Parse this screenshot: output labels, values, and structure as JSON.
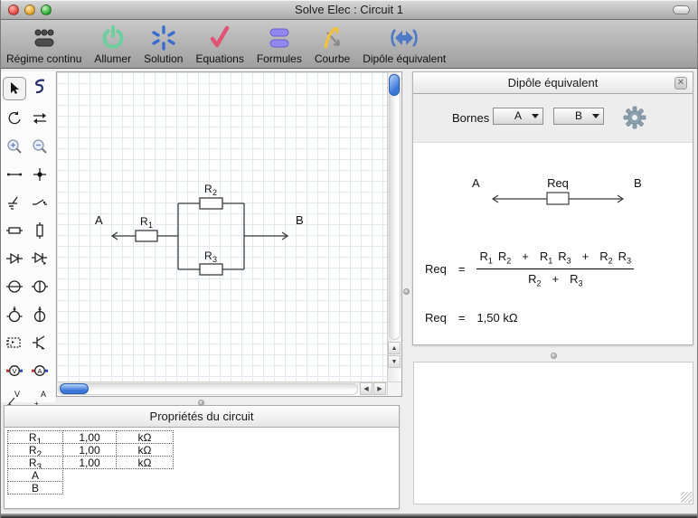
{
  "window": {
    "title": "Solve Elec : Circuit 1"
  },
  "titlebar": {
    "buttons": [
      "close",
      "minimize",
      "zoom"
    ],
    "toolbar_toggle": "pill"
  },
  "toolbar": {
    "items": [
      {
        "id": "regime-continu",
        "label": "Régime continu",
        "icon": "dc-supply-icon"
      },
      {
        "id": "allumer",
        "label": "Allumer",
        "icon": "power-icon"
      },
      {
        "id": "solution",
        "label": "Solution",
        "icon": "spark-icon"
      },
      {
        "id": "equations",
        "label": "Equations",
        "icon": "checkmark-icon"
      },
      {
        "id": "formules",
        "label": "Formules",
        "icon": "bars-icon"
      },
      {
        "id": "courbe",
        "label": "Courbe",
        "icon": "curve-icon"
      },
      {
        "id": "dipole-equivalent",
        "label": "Dipôle équivalent",
        "icon": "dipole-icon"
      }
    ]
  },
  "palette": {
    "tools": [
      {
        "id": "select-tool",
        "icon": "cursor",
        "selected": true
      },
      {
        "id": "freehand-wire-tool",
        "icon": "freehand",
        "selected": false
      },
      {
        "id": "rotate-tool",
        "icon": "rotate",
        "selected": false
      },
      {
        "id": "flip-tool",
        "icon": "swap",
        "selected": false
      },
      {
        "id": "zoom-in-tool",
        "icon": "zoomin",
        "selected": false
      },
      {
        "id": "zoom-out-tool",
        "icon": "zoomout",
        "selected": false
      },
      {
        "id": "wire-tool",
        "icon": "wire",
        "selected": false
      },
      {
        "id": "node-tool",
        "icon": "node",
        "selected": false
      },
      {
        "id": "ground-tool",
        "icon": "ground",
        "selected": false
      },
      {
        "id": "switch-tool",
        "icon": "switch",
        "selected": false
      },
      {
        "id": "resistor-h-tool",
        "icon": "resh",
        "selected": false
      },
      {
        "id": "resistor-v-tool",
        "icon": "resv",
        "selected": false
      },
      {
        "id": "diode-tool",
        "icon": "diode",
        "selected": false
      },
      {
        "id": "photodiode-tool",
        "icon": "photodiode",
        "selected": false
      },
      {
        "id": "voltage-source-tool",
        "icon": "srch",
        "selected": false
      },
      {
        "id": "current-source-tool",
        "icon": "srcv",
        "selected": false
      },
      {
        "id": "controlled-source-tool",
        "icon": "ctlsrc1",
        "selected": false
      },
      {
        "id": "controlled-source-2-tool",
        "icon": "ctlsrc2",
        "selected": false
      },
      {
        "id": "ic-box-tool",
        "icon": "icbox",
        "selected": false
      },
      {
        "id": "transistor-tool",
        "icon": "transistor",
        "selected": false
      },
      {
        "id": "voltmeter-tool",
        "icon": "voltmeter",
        "selected": false
      },
      {
        "id": "ammeter-tool",
        "icon": "ammeter",
        "selected": false
      },
      {
        "id": "voltage-probe-tool",
        "icon": "vprobe",
        "selected": false
      },
      {
        "id": "current-probe-tool",
        "icon": "aprobe",
        "selected": false
      }
    ]
  },
  "canvas": {
    "terminal_a": "A",
    "terminal_b": "B",
    "r1": {
      "t": "R",
      "s": "1"
    },
    "r2": {
      "t": "R",
      "s": "2"
    },
    "r3": {
      "t": "R",
      "s": "3"
    }
  },
  "dipole_panel": {
    "title": "Dipôle équivalent",
    "close_label": "✕",
    "bornes_label": "Bornes",
    "borne_a": "A",
    "borne_b": "B",
    "diagram": {
      "a": "A",
      "req": "Req",
      "b": "B"
    },
    "formula": {
      "lhs": "Req",
      "eq": "=",
      "numerator": [
        [
          "R",
          "1"
        ],
        [
          "R",
          "2"
        ],
        [
          "+",
          ""
        ],
        [
          "R",
          "1"
        ],
        [
          "R",
          "3"
        ],
        [
          "+",
          ""
        ],
        [
          "R",
          "2"
        ],
        [
          "R",
          "3"
        ]
      ],
      "denominator": [
        [
          "R",
          "2"
        ],
        [
          "+",
          ""
        ],
        [
          "R",
          "3"
        ]
      ],
      "result_lhs": "Req",
      "result_eq": "=",
      "result_value": "1,50 kΩ"
    }
  },
  "properties_panel": {
    "title": "Propriétés du circuit",
    "rows": [
      {
        "name": "R",
        "sub": "1",
        "value": "1,00",
        "unit": "kΩ"
      },
      {
        "name": "R",
        "sub": "2",
        "value": "1,00",
        "unit": "kΩ"
      },
      {
        "name": "R",
        "sub": "3",
        "value": "1,00",
        "unit": "kΩ"
      },
      {
        "name": "A",
        "sub": "",
        "value": null,
        "unit": null
      },
      {
        "name": "B",
        "sub": "",
        "value": null,
        "unit": null
      }
    ]
  },
  "colors": {
    "scroll_thumb": "#3b77d8",
    "power_green": "#6ecf9e",
    "solution_blue": "#3a6cd0",
    "check_red": "#e25273",
    "formula_purple": "#9287ec",
    "curve_yellow": "#f0c040",
    "dipole_blue": "#4d79c7"
  }
}
